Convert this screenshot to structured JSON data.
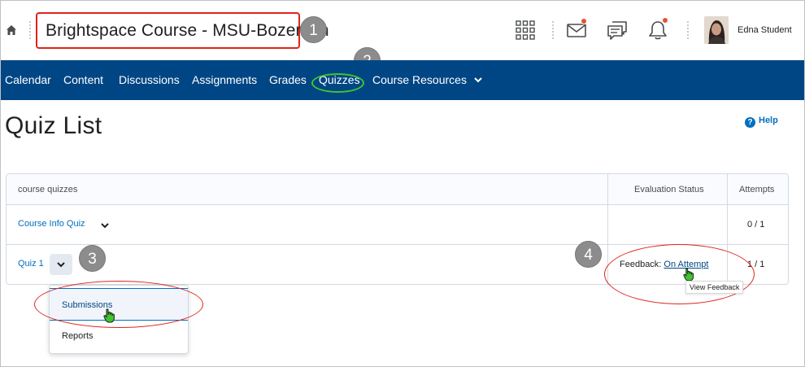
{
  "header": {
    "course_title": "Brightspace Course - MSU-Bozeman",
    "user_name": "Edna Student"
  },
  "callouts": [
    "1",
    "2",
    "3",
    "4"
  ],
  "nav": {
    "items": [
      {
        "label": "Calendar"
      },
      {
        "label": "Content"
      },
      {
        "label": "Discussions"
      },
      {
        "label": "Assignments"
      },
      {
        "label": "Grades"
      },
      {
        "label": "Quizzes"
      },
      {
        "label": "Course Resources"
      }
    ]
  },
  "page": {
    "title": "Quiz List",
    "help_label": "Help"
  },
  "table": {
    "columns": [
      "course quizzes",
      "Evaluation Status",
      "Attempts"
    ],
    "rows": [
      {
        "name": "Course Info Quiz",
        "status": "",
        "attempts": "0 / 1"
      },
      {
        "name": "Quiz 1",
        "status_prefix": "Feedback: ",
        "status_link": "On Attempt",
        "attempts": "1 / 1"
      }
    ]
  },
  "dropdown": {
    "items": [
      "Submissions",
      "Reports"
    ]
  },
  "tooltip": "View Feedback",
  "colors": {
    "nav_bg": "#004684",
    "link": "#006fbf",
    "highlight_red": "#e0231c",
    "highlight_green": "#3fc52f",
    "notification": "#e8522e"
  },
  "icons": [
    "home-icon",
    "waffle-grid-icon",
    "mail-icon",
    "chat-icon",
    "bell-icon",
    "help-icon",
    "chevron-down-icon",
    "hand-cursor-icon"
  ]
}
